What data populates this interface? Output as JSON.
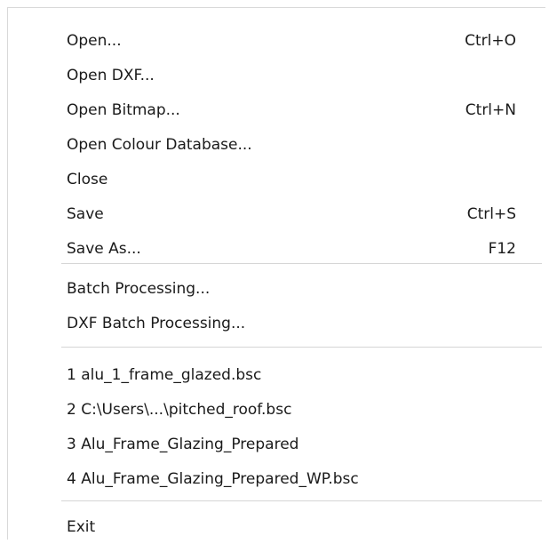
{
  "menu": {
    "items": [
      {
        "label": "Open...",
        "shortcut": "Ctrl+O"
      },
      {
        "label": "Open DXF...",
        "shortcut": ""
      },
      {
        "label": "Open Bitmap...",
        "shortcut": "Ctrl+N"
      },
      {
        "label": "Open Colour Database...",
        "shortcut": ""
      },
      {
        "label": "Close",
        "shortcut": ""
      },
      {
        "label": "Save",
        "shortcut": "Ctrl+S"
      },
      {
        "label": "Save As...",
        "shortcut": "F12"
      },
      {
        "label": "Batch Processing...",
        "shortcut": ""
      },
      {
        "label": "DXF Batch Processing...",
        "shortcut": ""
      },
      {
        "label": "1 alu_1_frame_glazed.bsc",
        "shortcut": ""
      },
      {
        "label": "2 C:\\Users\\...\\pitched_roof.bsc",
        "shortcut": ""
      },
      {
        "label": "3 Alu_Frame_Glazing_Prepared",
        "shortcut": ""
      },
      {
        "label": "4 Alu_Frame_Glazing_Prepared_WP.bsc",
        "shortcut": ""
      },
      {
        "label": "Exit",
        "shortcut": ""
      }
    ]
  }
}
